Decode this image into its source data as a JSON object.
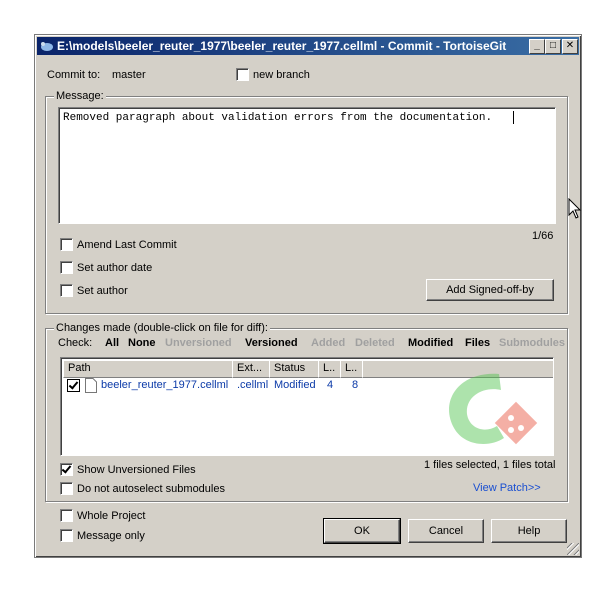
{
  "window": {
    "title": "E:\\models\\beeler_reuter_1977\\beeler_reuter_1977.cellml - Commit - TortoiseGit",
    "minimize": "_",
    "maximize": "□",
    "close": "✕"
  },
  "commit_to": {
    "label": "Commit to:",
    "branch": "master"
  },
  "new_branch": {
    "label": "new branch",
    "checked": false
  },
  "message": {
    "group_label": "Message:",
    "text": "Removed paragraph about validation errors from the documentation.",
    "counter": "1/66"
  },
  "options": {
    "amend": "Amend Last Commit",
    "author_date": "Set author date",
    "author": "Set author",
    "signed_off_button": "Add Signed-off-by"
  },
  "changes": {
    "group_label": "Changes made (double-click on file for diff):",
    "check_label": "Check:",
    "filters": [
      {
        "label": "All",
        "enabled": true
      },
      {
        "label": "None",
        "enabled": true
      },
      {
        "label": "Unversioned",
        "enabled": false
      },
      {
        "label": "Versioned",
        "enabled": true
      },
      {
        "label": "Added",
        "enabled": false
      },
      {
        "label": "Deleted",
        "enabled": false
      },
      {
        "label": "Modified",
        "enabled": true
      },
      {
        "label": "Files",
        "enabled": true
      },
      {
        "label": "Submodules",
        "enabled": false
      }
    ],
    "columns": [
      "Path",
      "Ext...",
      "Status",
      "L..",
      "L.."
    ],
    "rows": [
      {
        "checked": true,
        "path": "beeler_reuter_1977.cellml",
        "ext": ".cellml",
        "status": "Modified",
        "added": "4",
        "deleted": "8"
      }
    ],
    "show_unversioned": {
      "label": "Show Unversioned Files",
      "checked": true
    },
    "no_autoselect": {
      "label": "Do not autoselect submodules",
      "checked": false
    },
    "selection_summary": "1 files selected, 1 files total",
    "view_patch": "View Patch>>"
  },
  "bottom": {
    "whole_project": "Whole Project",
    "message_only": "Message only",
    "ok": "OK",
    "cancel": "Cancel",
    "help": "Help"
  },
  "colors": {
    "title_start": "#0a246a",
    "title_end": "#3a6ea5",
    "face": "#d4d0c8",
    "link": "#1a4fd1",
    "logo_green": "#4cc24a",
    "logo_red": "#e8503a"
  }
}
